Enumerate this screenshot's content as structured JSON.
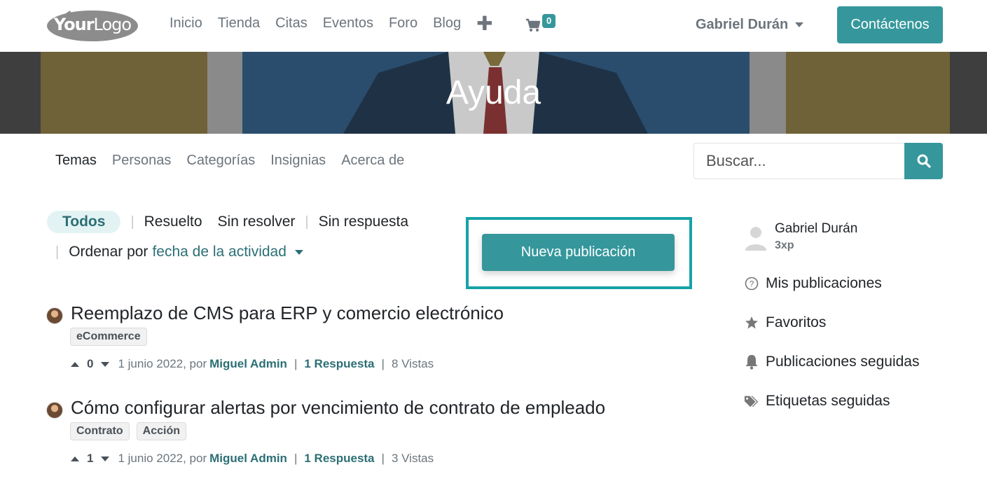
{
  "navbar": {
    "logo": {
      "bold": "Your",
      "regular": "Logo"
    },
    "links": [
      "Inicio",
      "Tienda",
      "Citas",
      "Eventos",
      "Foro",
      "Blog"
    ],
    "plus_icon": "plus-icon",
    "cart": {
      "icon": "cart-icon",
      "count": "0"
    },
    "user_name": "Gabriel Durán",
    "contact_label": "Contáctenos"
  },
  "banner": {
    "title": "Ayuda"
  },
  "subnav": {
    "items": [
      "Temas",
      "Personas",
      "Categorías",
      "Insignias",
      "Acerca de"
    ],
    "active": "Temas"
  },
  "search": {
    "placeholder": "Buscar...",
    "icon": "search-icon"
  },
  "filters": {
    "all": "Todos",
    "solved": "Resuelto",
    "unsolved": "Sin resolver",
    "unanswered": "Sin respuesta",
    "sort_label": "Ordenar por",
    "sort_value": "fecha de la actividad"
  },
  "new_post_label": "Nueva publicación",
  "posts": [
    {
      "title": "Reemplazo de CMS para ERP y comercio electrónico",
      "tags": [
        "eCommerce"
      ],
      "votes": "0",
      "date": "1 junio 2022, por",
      "author": "Miguel Admin",
      "answers": "1 Respuesta",
      "views": "8 Vistas"
    },
    {
      "title": "Cómo configurar alertas por vencimiento de contrato de empleado",
      "tags": [
        "Contrato",
        "Acción"
      ],
      "votes": "1",
      "date": "1 junio 2022, por",
      "author": "Miguel Admin",
      "answers": "1 Respuesta",
      "views": "3 Vistas"
    }
  ],
  "sidebar": {
    "user_name": "Gabriel Durán",
    "xp": "3xp",
    "items": [
      {
        "label": "Mis publicaciones",
        "icon": "question-circle-icon"
      },
      {
        "label": "Favoritos",
        "icon": "star-icon"
      },
      {
        "label": "Publicaciones seguidas",
        "icon": "bell-icon"
      },
      {
        "label": "Etiquetas seguidas",
        "icon": "tags-icon"
      }
    ]
  },
  "colors": {
    "primary": "#35979c",
    "link": "#2c6f75",
    "highlight": "#17a2a6"
  }
}
